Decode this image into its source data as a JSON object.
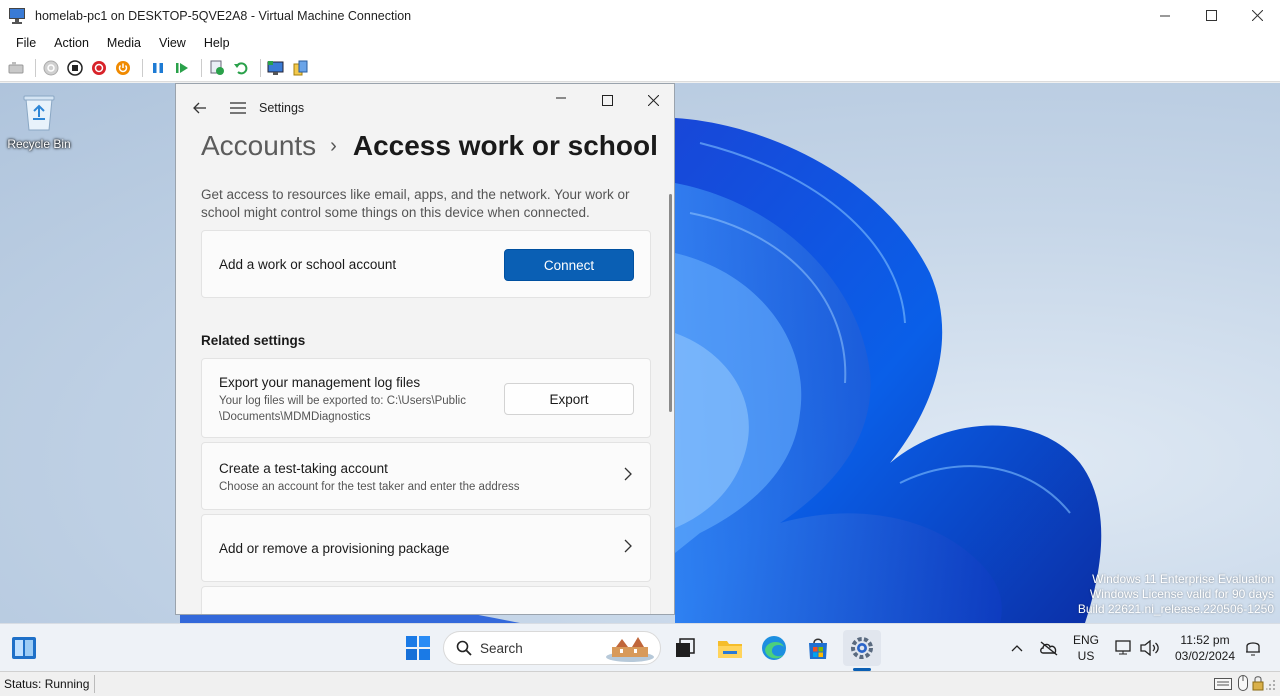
{
  "vm_window": {
    "title": "homelab-pc1 on DESKTOP-5QVE2A8 - Virtual Machine Connection",
    "menu": [
      "File",
      "Action",
      "Media",
      "View",
      "Help"
    ],
    "toolbar_icons": [
      "ctrl-alt-del-icon",
      "start-icon",
      "turn-off-icon",
      "shutdown-icon",
      "power-button-icon",
      "pause-icon",
      "resume-icon",
      "checkpoint-icon",
      "revert-icon",
      "enhanced-session-icon",
      "share-icon"
    ]
  },
  "desktop": {
    "recycle_bin_label": "Recycle Bin",
    "watermark": {
      "line1": "Windows 11 Enterprise Evaluation",
      "line2": "Windows License valid for 90 days",
      "line3": "Build 22621.ni_release.220506-1250"
    }
  },
  "settings": {
    "app_title": "Settings",
    "breadcrumb_parent": "Accounts",
    "breadcrumb_separator": "›",
    "breadcrumb_current": "Access work or school",
    "intro": "Get access to resources like email, apps, and the network. Your work or school might control some things on this device when connected.",
    "add_account": {
      "label": "Add a work or school account",
      "button": "Connect"
    },
    "related_heading": "Related settings",
    "export": {
      "title": "Export your management log files",
      "sub_line1": "Your log files will be exported to: C:\\Users\\Public",
      "sub_line2": "\\Documents\\MDMDiagnostics",
      "button": "Export"
    },
    "test_account": {
      "title": "Create a test-taking account",
      "sub": "Choose an account for the test taker and enter the address"
    },
    "provisioning": {
      "title": "Add or remove a provisioning package"
    }
  },
  "taskbar": {
    "search_label": "Search",
    "lang_line1": "ENG",
    "lang_line2": "US",
    "time": "11:52 pm",
    "date": "03/02/2024",
    "accent_color": "#0a5fb4"
  },
  "statusbar": {
    "status": "Status: Running"
  }
}
